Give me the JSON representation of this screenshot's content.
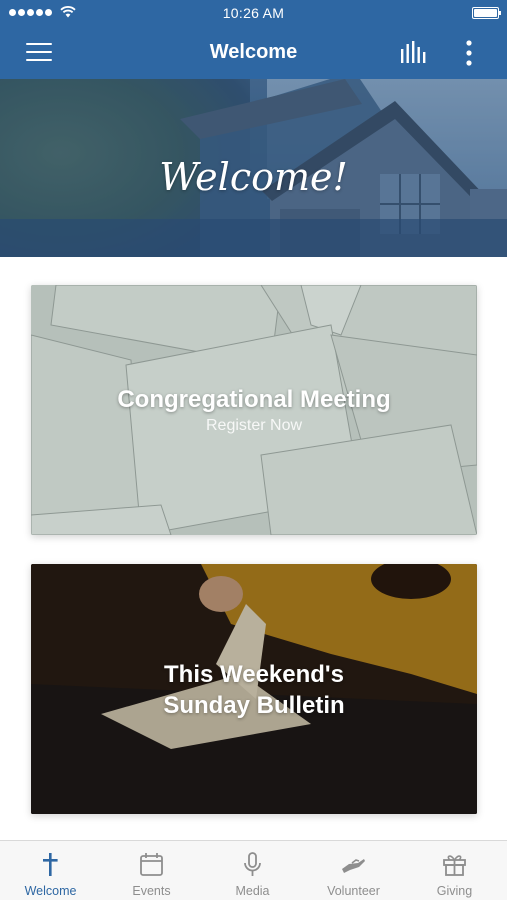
{
  "status_bar": {
    "time": "10:26 AM"
  },
  "nav": {
    "title": "Welcome"
  },
  "hero": {
    "title": "Welcome!"
  },
  "cards": [
    {
      "title": "Congregational Meeting",
      "subtitle": "Register Now"
    },
    {
      "title_line1": "This Weekend's",
      "title_line2": "Sunday Bulletin"
    }
  ],
  "tabs": [
    {
      "label": "Welcome",
      "icon": "cross-icon",
      "active": true
    },
    {
      "label": "Events",
      "icon": "calendar-icon",
      "active": false
    },
    {
      "label": "Media",
      "icon": "microphone-icon",
      "active": false
    },
    {
      "label": "Volunteer",
      "icon": "helping-hand-icon",
      "active": false
    },
    {
      "label": "Giving",
      "icon": "gift-icon",
      "active": false
    }
  ],
  "colors": {
    "brand": "#2e67a3",
    "tab_inactive": "#8e8e8e"
  }
}
